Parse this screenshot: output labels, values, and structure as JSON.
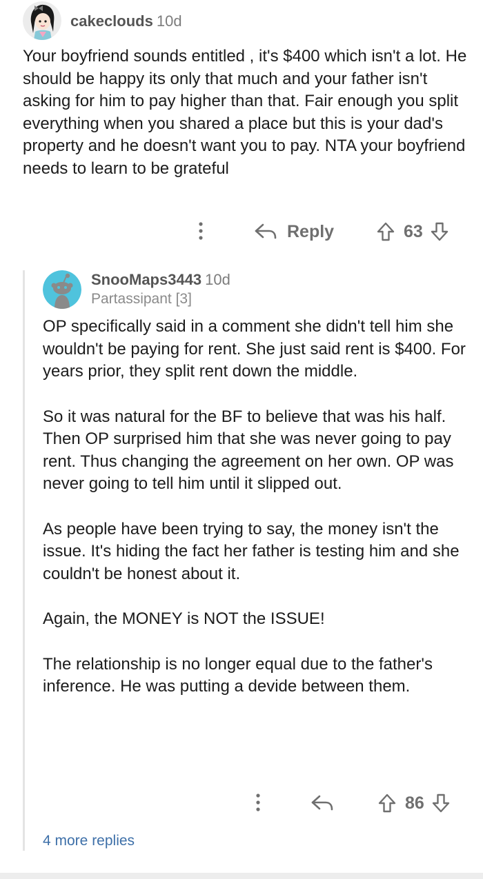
{
  "comment": {
    "author": "cakeclouds",
    "age": "10d",
    "body": [
      "Your boyfriend sounds entitled , it's $400 which isn't a lot. He should be happy its only that much and your father isn't asking for him to pay higher than that. Fair enough you split everything when you shared a place but this is your dad's property and he doesn't want you to pay. NTA your boyfriend needs to learn to be grateful"
    ],
    "reply_label": "Reply",
    "score": "63"
  },
  "reply": {
    "author": "SnooMaps3443",
    "age": "10d",
    "flair": "Partassipant [3]",
    "body": [
      "OP specifically said in a comment she didn't tell him she wouldn't be paying for rent. She just said rent is $400. For years prior, they split rent down the middle.",
      "So it was natural for the BF to believe that was his half. Then OP surprised him that she was never going to pay rent. Thus changing the agreement on her own. OP was never going to tell him until it slipped out.",
      "As people have been trying to say, the money isn't the issue. It's hiding the fact her father is testing him and she couldn't be honest about it.",
      "Again, the MONEY is NOT the ISSUE!",
      "The relationship is no longer equal due to the father's inference. He was putting a devide between them."
    ],
    "score": "86",
    "more_replies": "4 more replies"
  },
  "icons": {
    "overflow": "more-vertical-icon",
    "reply": "reply-arrow-icon",
    "upvote": "upvote-arrow-icon",
    "downvote": "downvote-arrow-icon"
  },
  "colors": {
    "meta_text": "#6f6f6f",
    "link": "#3d6fa8",
    "thread_line": "#e4e4e4",
    "snoo_bg": "#4fc3dd"
  }
}
